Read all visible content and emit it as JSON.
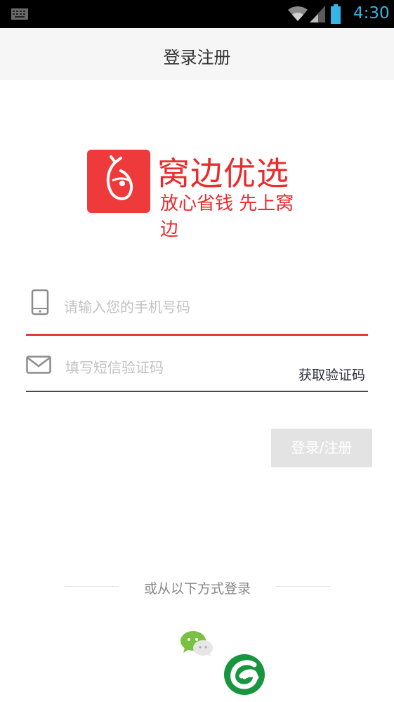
{
  "status_bar": {
    "time": "4:30",
    "icons": [
      "keyboard-icon",
      "wifi-icon",
      "signal-icon",
      "battery-icon"
    ],
    "accent_color": "#33b5e5"
  },
  "header": {
    "title": "登录注册"
  },
  "logo": {
    "name": "窝边优选",
    "slogan": "放心省钱 先上窝边",
    "brand_color": "#ea2c2e"
  },
  "form": {
    "phone": {
      "placeholder": "请输入您的手机号码",
      "value": "",
      "icon": "phone-icon"
    },
    "code": {
      "placeholder": "填写短信验证码",
      "value": "",
      "icon": "envelope-icon",
      "get_code_label": "获取验证码"
    },
    "submit_label": "登录/注册"
  },
  "other_login": {
    "label": "或从以下方式登录",
    "options": [
      "wechat-icon"
    ]
  },
  "overlay_badge": "green-logo-icon"
}
